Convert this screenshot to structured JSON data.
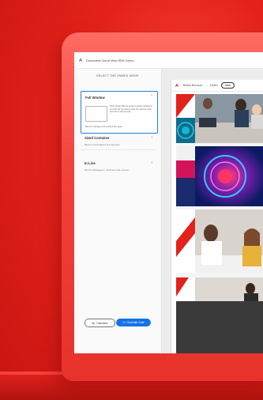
{
  "app": {
    "title": "Document Cloud View SDK Demo"
  },
  "left_panel": {
    "heading": "SELECT THE EMBED MODE",
    "modes": [
      {
        "label": "Full Window",
        "selected": true,
        "description": "PDF Viewer fills the entire browser window to provide full immersive view for users to read and act on documents.",
        "usage": "Best for storage and productivity apps"
      },
      {
        "label": "Sized Container",
        "selected": false,
        "usage": "Best for presentations and keynotes"
      },
      {
        "label": "In-Line",
        "selected": false,
        "usage": "Best for whitepapers, brochures and e-books"
      }
    ],
    "buttons": {
      "customize": "Customize",
      "generate": "Generate Code"
    }
  },
  "viewer": {
    "file_name": "Bodea Brochure",
    "status": "Edited",
    "save_label": "Save"
  },
  "colors": {
    "brand_red": "#e3221b",
    "accent_blue": "#1473e6",
    "selected_border": "#2b7de1"
  },
  "icons": {
    "app_logo": "adobe-acrobat-icon",
    "chevron": "chevron-down-icon",
    "customize": "sliders-icon",
    "generate": "code-icon"
  }
}
